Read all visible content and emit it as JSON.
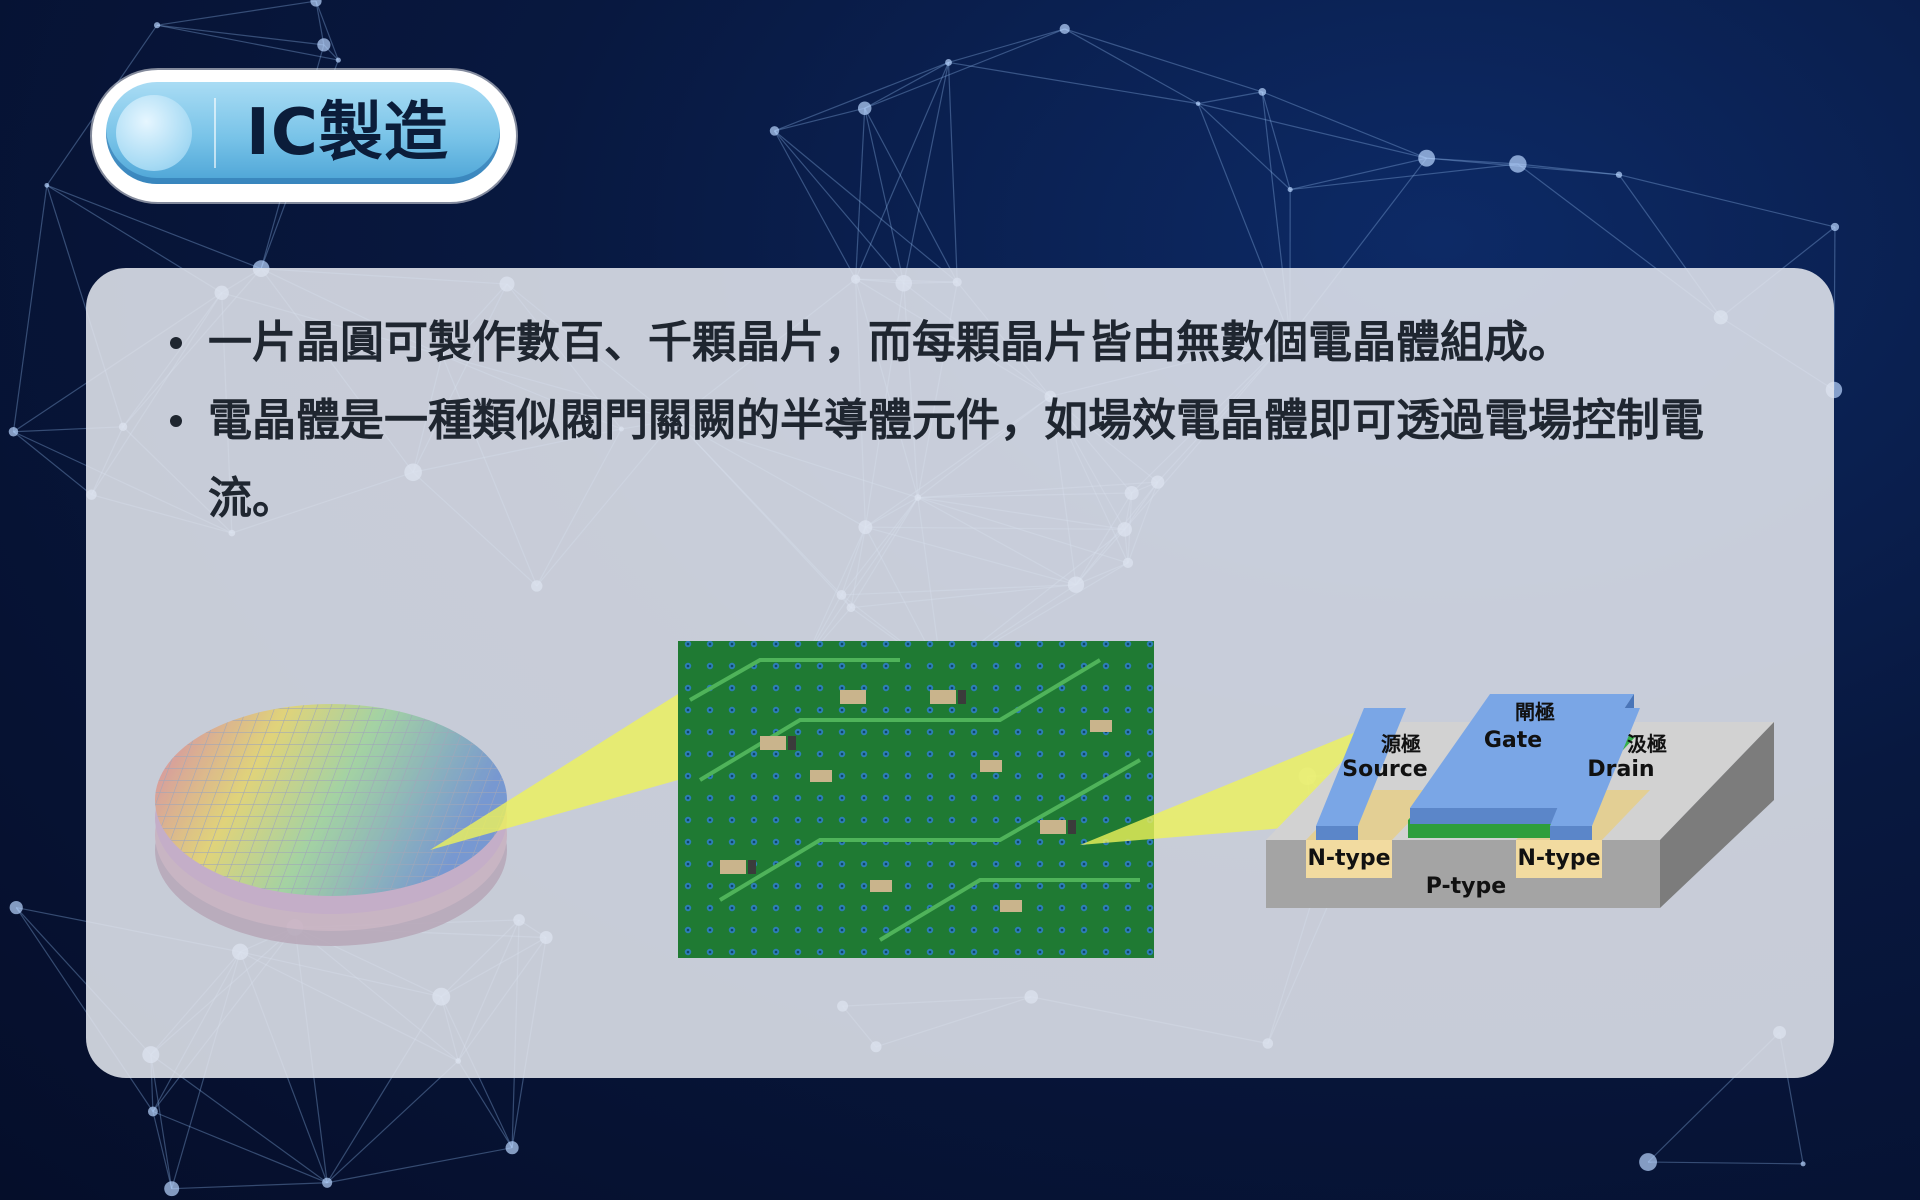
{
  "title": "IC製造",
  "bullets": [
    "一片晶圓可製作數百、千顆晶片，而每顆晶片皆由無數個電晶體組成。",
    "電晶體是一種類似閥門關闕的半導體元件，如場效電晶體即可透過電場控制電流。"
  ],
  "transistor": {
    "gate_cn": "閘極",
    "gate_en": "Gate",
    "source_cn": "源極",
    "source_en": "Source",
    "drain_cn": "汲極",
    "drain_en": "Drain",
    "ntype_left": "N-type",
    "ntype_right": "N-type",
    "ptype": "P-type"
  },
  "colors": {
    "background": "#08183f",
    "title_fill": "#78c3e8",
    "panel": "#e2e6ee",
    "text": "#1f2630",
    "callout": "#eef25a",
    "gate_metal": "#5b86c9",
    "oxide": "#2e9e3c",
    "ntype": "#f2dba0",
    "ptype": "#a4a4a4",
    "pcb_green": "#1f7a33"
  },
  "icons": [
    "wafer-stack-image",
    "pcb-photo",
    "mosfet-diagram"
  ]
}
